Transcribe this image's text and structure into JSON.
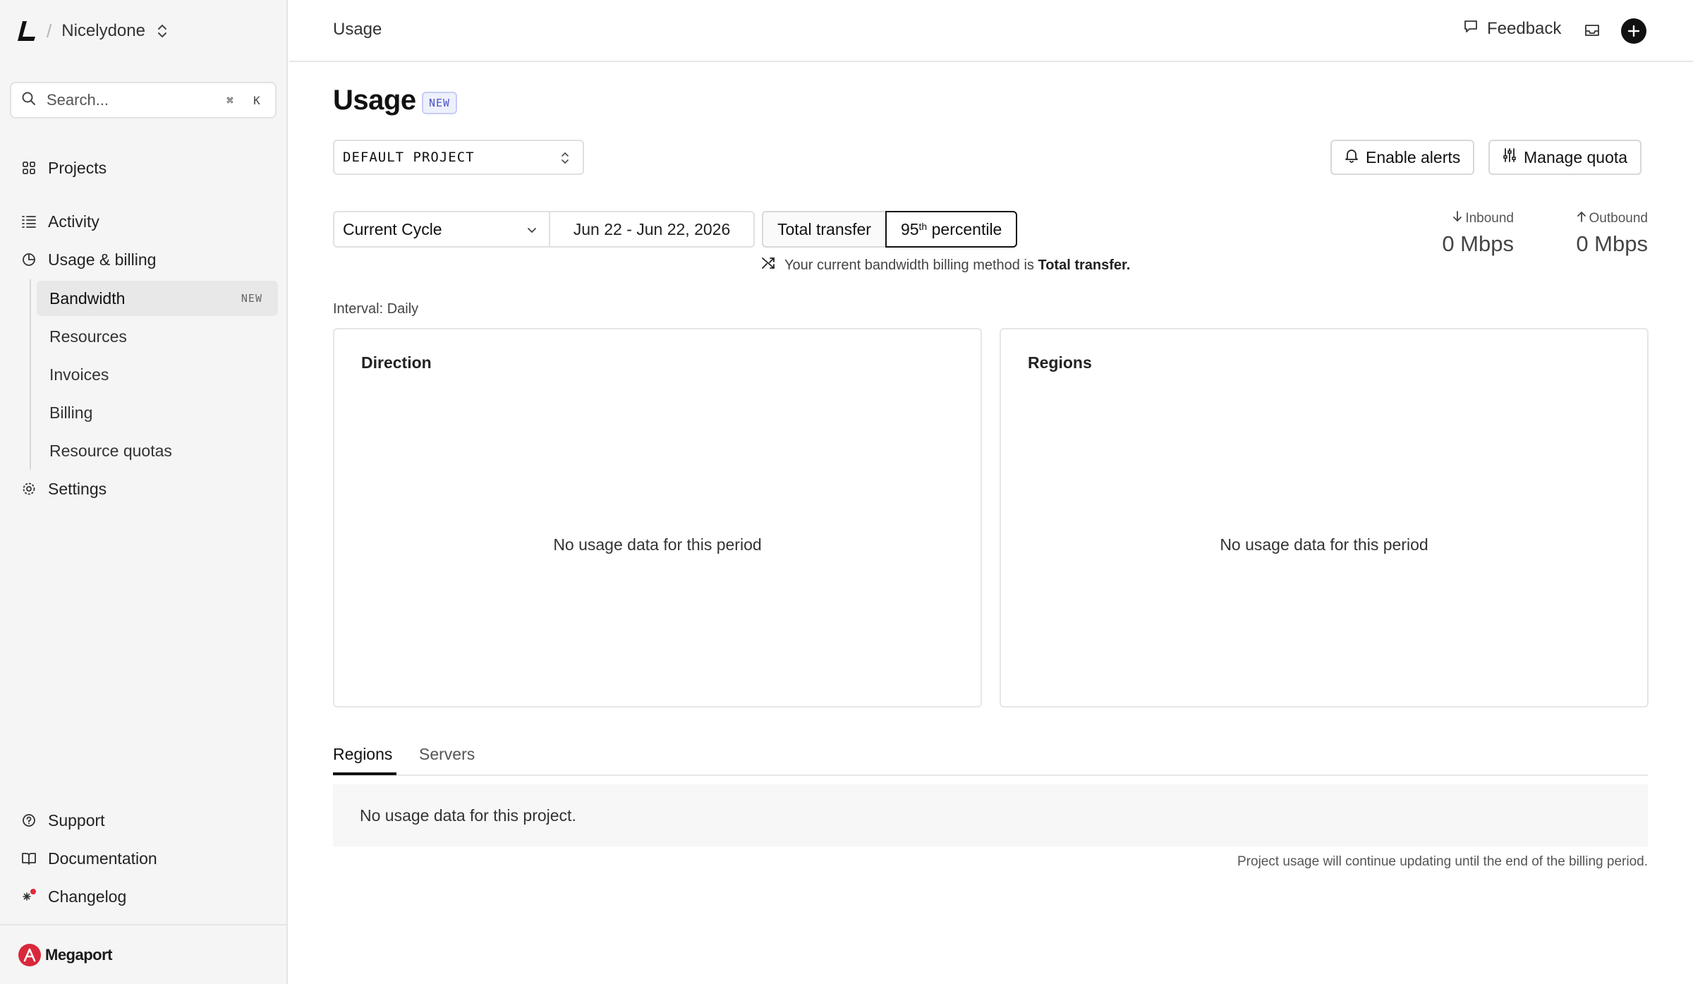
{
  "sidebar": {
    "org_name": "Nicelydone",
    "search_placeholder": "Search...",
    "search_shortcut": [
      "⌘",
      "K"
    ],
    "items": [
      {
        "label": "Projects",
        "icon": "grid-icon"
      },
      {
        "label": "Activity",
        "icon": "list-icon"
      },
      {
        "label": "Usage & billing",
        "icon": "pie-chart-icon"
      },
      {
        "label": "Settings",
        "icon": "gear-icon"
      }
    ],
    "sub_items": [
      {
        "label": "Bandwidth",
        "badge": "NEW",
        "active": true
      },
      {
        "label": "Resources"
      },
      {
        "label": "Invoices"
      },
      {
        "label": "Billing"
      },
      {
        "label": "Resource quotas"
      }
    ],
    "bottom_items": [
      {
        "label": "Support",
        "icon": "help-circle-icon"
      },
      {
        "label": "Documentation",
        "icon": "book-icon"
      },
      {
        "label": "Changelog",
        "icon": "sparkle-icon"
      }
    ],
    "footer_brand": "Megaport"
  },
  "topbar": {
    "breadcrumb": "Usage",
    "feedback_label": "Feedback"
  },
  "main": {
    "title": "Usage",
    "title_badge": "NEW",
    "project_select": "DEFAULT PROJECT",
    "enable_alerts_label": "Enable alerts",
    "manage_quota_label": "Manage quota",
    "cycle_select": "Current Cycle",
    "date_range": "Jun 22 - Jun 22, 2026",
    "billing_toggle": {
      "total_transfer": "Total transfer",
      "percentile_prefix": "95",
      "percentile_sup": "th",
      "percentile_suffix": " percentile"
    },
    "billing_note_prefix": "Your current bandwidth billing method is ",
    "billing_note_method": "Total transfer.",
    "stats": {
      "inbound_label": "Inbound",
      "inbound_value": "0 Mbps",
      "outbound_label": "Outbound",
      "outbound_value": "0 Mbps"
    },
    "interval": "Interval: Daily",
    "panels": [
      {
        "title": "Direction",
        "empty": "No usage data for this period"
      },
      {
        "title": "Regions",
        "empty": "No usage data for this period"
      }
    ],
    "tabs": [
      "Regions",
      "Servers"
    ],
    "table_empty": "No usage data for this project.",
    "footnote": "Project usage will continue updating until the end of the billing period."
  }
}
